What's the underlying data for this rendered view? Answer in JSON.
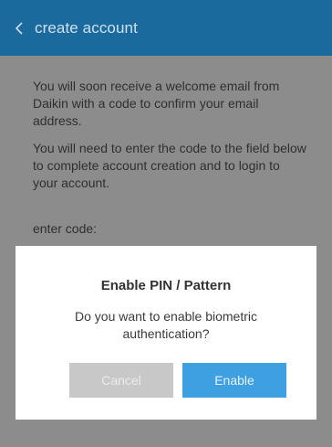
{
  "header": {
    "title": "create account",
    "bar_color": "#1b6a9e"
  },
  "body": {
    "paragraph1": "You will soon receive a welcome email from Daikin with a code to confirm your email address.",
    "paragraph2": "You will need to enter the code to the field below to complete account creation and to login to your account.",
    "code_label": "enter code:"
  },
  "dialog": {
    "title": "Enable PIN / Pattern",
    "message": "Do you want to enable biometric authentication?",
    "cancel_label": "Cancel",
    "enable_label": "Enable",
    "cancel_color": "#c8c8c8",
    "enable_color": "#3ea0e0"
  },
  "icons": {
    "back": "chevron-left-icon"
  }
}
